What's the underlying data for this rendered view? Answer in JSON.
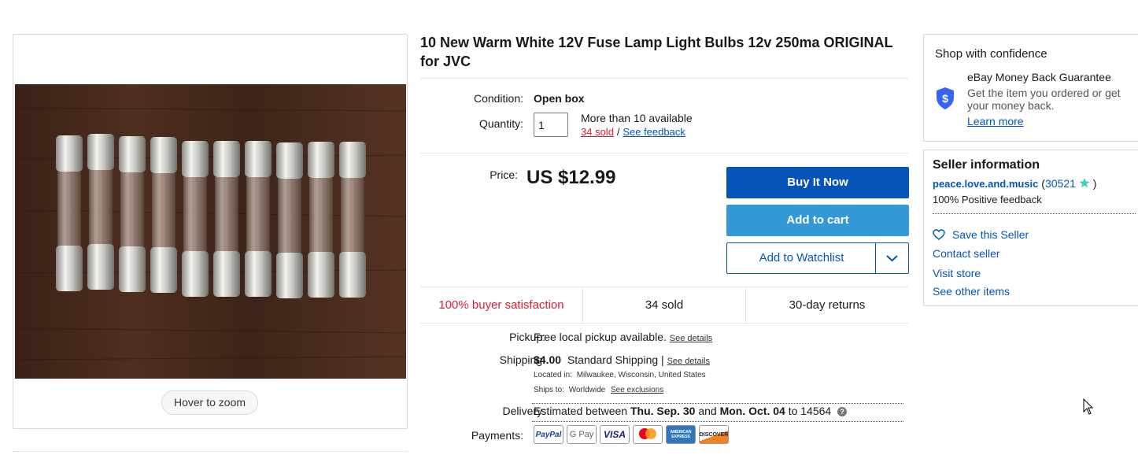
{
  "gallery": {
    "zoom_label": "Hover to zoom"
  },
  "item": {
    "title": "10 New Warm White 12V Fuse Lamp Light Bulbs 12v 250ma ORIGINAL for JVC",
    "condition_label": "Condition:",
    "condition_value": "Open box",
    "quantity_label": "Quantity:",
    "quantity_value": "1",
    "availability": "More than 10 available",
    "sold_link": "34 sold",
    "separator": "/",
    "feedback_link": "See feedback",
    "price_label": "Price:",
    "price": "US $12.99"
  },
  "actions": {
    "buy_now": "Buy It Now",
    "add_to_cart": "Add to cart",
    "add_to_watchlist": "Add to Watchlist"
  },
  "stats": {
    "satisfaction": "100% buyer satisfaction",
    "sold": "34 sold",
    "returns": "30-day returns"
  },
  "pickup": {
    "label": "Pickup:",
    "text": "Free local pickup available.",
    "link": "See details"
  },
  "shipping": {
    "label": "Shipping:",
    "cost": "$4.00",
    "method": "Standard Shipping |",
    "link": "See details",
    "location_label": "Located in:",
    "location": "Milwaukee, Wisconsin, United States",
    "ships_label": "Ships to:",
    "ships_to": "Worldwide",
    "exclusions_link": "See exclusions"
  },
  "delivery": {
    "label": "Delivery:",
    "prefix": "Estimated between",
    "start": "Thu. Sep. 30",
    "and": "and",
    "end": "Mon. Oct. 04",
    "to": "to 14564",
    "help": "?"
  },
  "payments": {
    "label": "Payments:",
    "methods": [
      "PayPal",
      "G Pay",
      "VISA",
      "mastercard",
      "AMERICAN EXPRESS",
      "DISCOVER"
    ]
  },
  "confidence": {
    "title": "Shop with confidence",
    "guarantee_title": "eBay Money Back Guarantee",
    "guarantee_text": "Get the item you ordered or get your money back.",
    "learn_more": "Learn more",
    "shield_symbol": "$"
  },
  "seller": {
    "title": "Seller information",
    "name": "peace.love.and.music",
    "open_paren": "(",
    "score": "30521",
    "close_paren": ")",
    "feedback": "100% Positive feedback",
    "save_seller": "Save this Seller",
    "contact": "Contact seller",
    "visit_store": "Visit store",
    "other_items": "See other items"
  },
  "colors": {
    "primary_blue": "#0654ba",
    "cart_blue": "#3399d6",
    "sold_red": "#dd1e31",
    "star_teal": "#3fd0c0"
  }
}
